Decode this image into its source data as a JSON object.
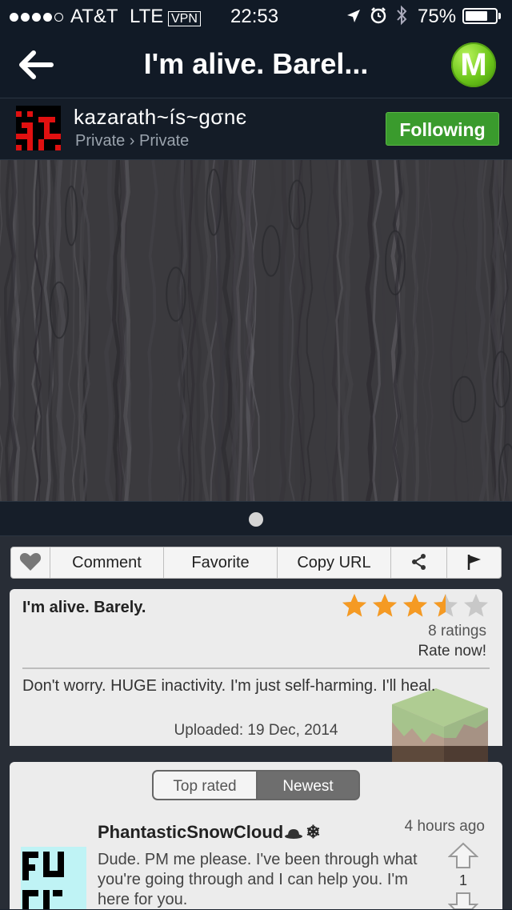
{
  "status_bar": {
    "carrier": "AT&T",
    "network": "LTE",
    "vpn": "VPN",
    "time": "22:53",
    "battery": "75%",
    "battery_level": 0.75,
    "signal_bars": 4
  },
  "nav": {
    "title": "I'm alive. Barel...",
    "logo_letter": "M",
    "icons": [
      "back-arrow-icon",
      "m-logo-icon"
    ]
  },
  "user": {
    "name": "kazarath~ís~gσnє",
    "subtitle": "Private › Private",
    "follow_label": "Following"
  },
  "pager": {
    "pages": 1,
    "current": 1
  },
  "actions": {
    "comment_label": "Comment",
    "favorite_label": "Favorite",
    "copy_url_label": "Copy URL",
    "icons": [
      "heart-icon",
      "share-icon",
      "flag-icon"
    ]
  },
  "post": {
    "title": "I'm alive. Barely.",
    "rating": 3.5,
    "rating_max": 5,
    "ratings_count": "8 ratings",
    "rate_now": "Rate now!",
    "description": "Don't worry. HUGE inactivity. I'm just self-harming. I'll heal.",
    "uploaded": "Uploaded: 19 Dec, 2014"
  },
  "comments": {
    "sort_tabs": [
      "Top rated",
      "Newest"
    ],
    "selected_tab": "Newest",
    "items": [
      {
        "user": "PhantasticSnowCloud",
        "time": "4 hours ago",
        "text": "Dude. PM me please. I've been through what you're going through and I can help you. I'm here for you.",
        "votes": "1"
      }
    ]
  },
  "colors": {
    "nav_bg": "#111a26",
    "follow_green": "#3a9b2d",
    "star_orange": "#f59a23",
    "logo_green": "#6cc51a"
  }
}
